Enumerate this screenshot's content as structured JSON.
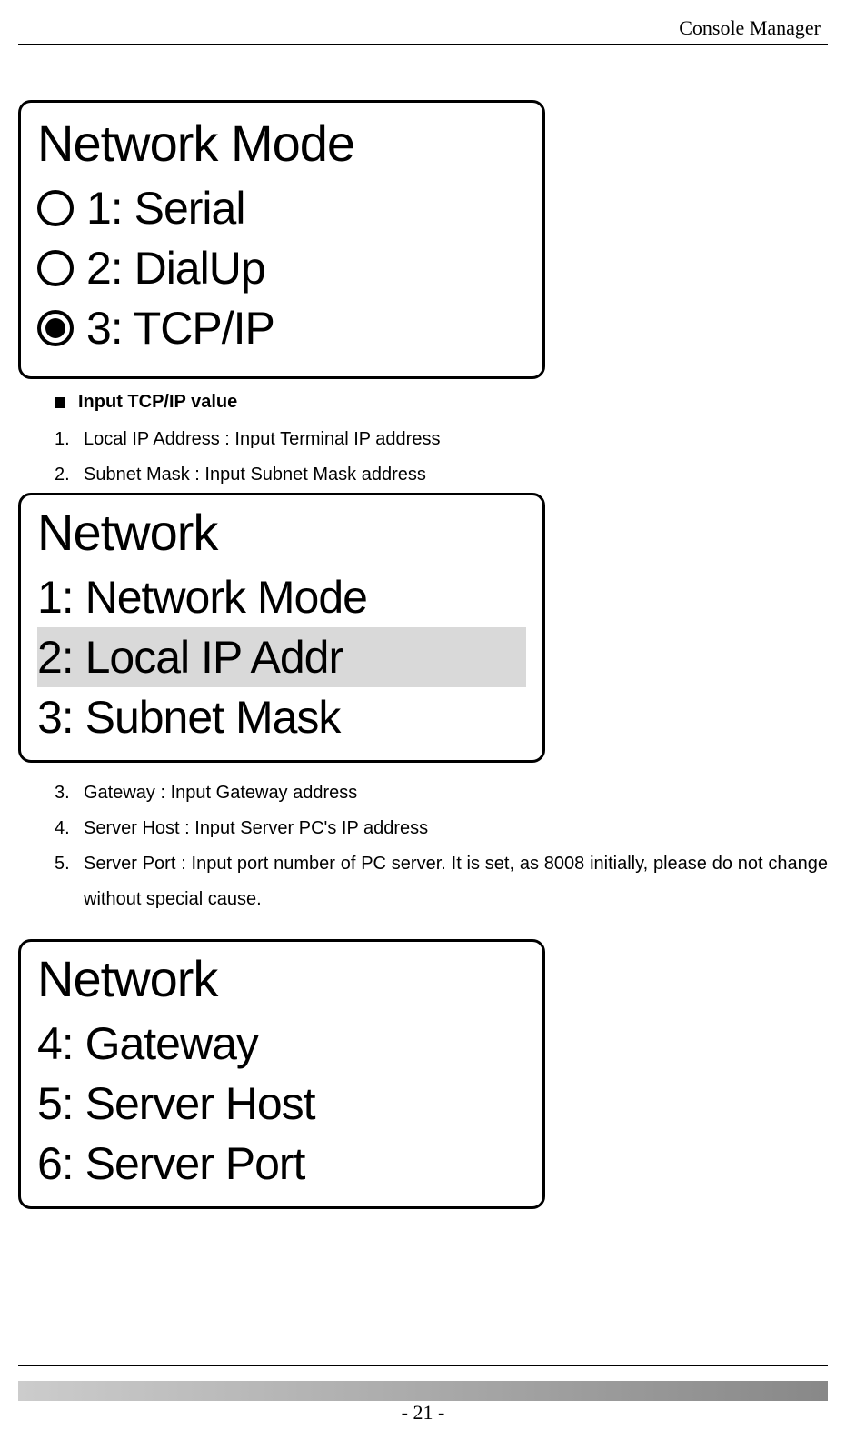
{
  "header": {
    "title": "Console Manager"
  },
  "panel1": {
    "title": "Network Mode",
    "options": [
      {
        "label": "1: Serial",
        "selected": false
      },
      {
        "label": "2: DialUp",
        "selected": false
      },
      {
        "label": "3: TCP/IP",
        "selected": true
      }
    ]
  },
  "section_heading": "Input TCP/IP value",
  "list_a": [
    {
      "marker": "1.",
      "text": "Local IP Address : Input Terminal IP address"
    },
    {
      "marker": "2.",
      "text": "Subnet Mask : Input Subnet Mask address"
    }
  ],
  "panel2": {
    "title": "Network",
    "items": [
      {
        "label": "1: Network Mode",
        "highlight": false
      },
      {
        "label": "2: Local IP Addr",
        "highlight": true
      },
      {
        "label": "3: Subnet Mask",
        "highlight": false
      }
    ]
  },
  "list_b": [
    {
      "marker": "3.",
      "text": "Gateway : Input Gateway address"
    },
    {
      "marker": "4.",
      "text": "Server Host : Input Server PC's IP address"
    },
    {
      "marker": "5.",
      "text": "Server Port : Input port number of PC server. It is set, as 8008 initially, please do not change without special cause."
    }
  ],
  "panel3": {
    "title": "Network",
    "items": [
      {
        "label": "4: Gateway"
      },
      {
        "label": "5: Server Host"
      },
      {
        "label": "6: Server Port"
      }
    ]
  },
  "footer": {
    "page": "- 21 -"
  }
}
